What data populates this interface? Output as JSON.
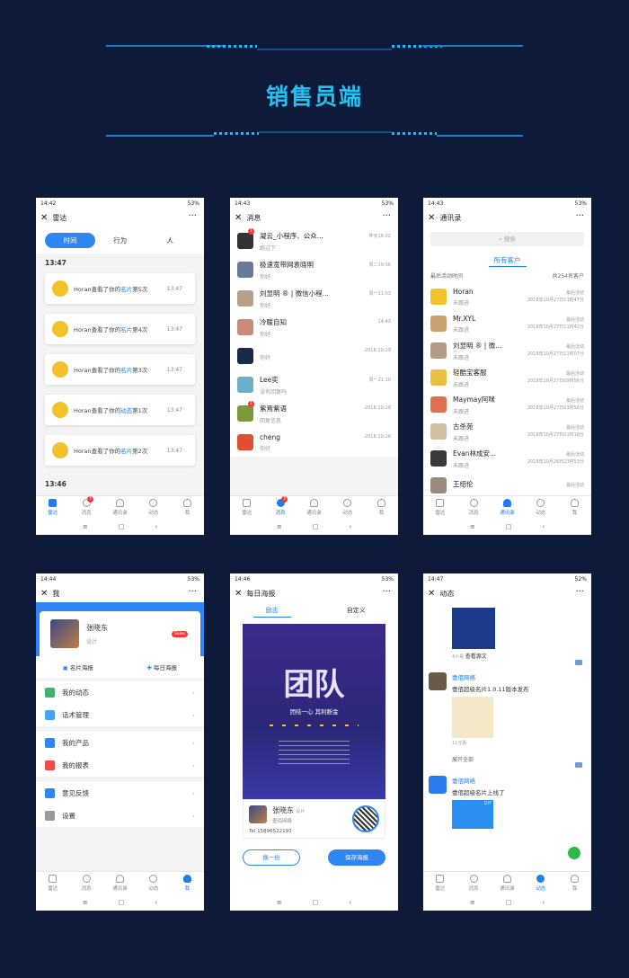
{
  "header": {
    "title": "销售员端"
  },
  "bottom_nav": [
    "雷达",
    "消息",
    "通讯录",
    "动态",
    "我"
  ],
  "sysnav": [
    "≡",
    "□",
    "‹"
  ],
  "p1": {
    "time": "14:42",
    "battery": "53%",
    "title": "雷达",
    "more": "···",
    "tabs": [
      "时间",
      "行为",
      "人"
    ],
    "section1": "13:47",
    "section2": "13:46",
    "cards": [
      {
        "name": "Horan",
        "verb": "查看了你的",
        "obj": "名片",
        "suffix": "第5次",
        "time": "13:47"
      },
      {
        "name": "Horan",
        "verb": "查看了你的",
        "obj": "名片",
        "suffix": "第4次",
        "time": "13:47"
      },
      {
        "name": "Horan",
        "verb": "查看了你的",
        "obj": "名片",
        "suffix": "第3次",
        "time": "13:47"
      },
      {
        "name": "Horan",
        "verb": "查看了你的",
        "obj": "动态",
        "suffix": "第1次",
        "time": "13:47"
      },
      {
        "name": "Horan",
        "verb": "查看了你的",
        "obj": "名片",
        "suffix": "第2次",
        "time": "13:47"
      }
    ],
    "badge": "3"
  },
  "p2": {
    "time": "14:43",
    "battery": "53%",
    "title": "消息",
    "more": "···",
    "badge": "3",
    "rows": [
      {
        "name": "凝云_小程序、公众...",
        "sub": "跑过下",
        "time": "昨天18:02",
        "badge": "1"
      },
      {
        "name": "极速宽带网袁晓明",
        "sub": "你好",
        "time": "周二19:36"
      },
      {
        "name": "刘显明 ® | 微信小程...",
        "sub": "你好",
        "time": "周一11:03"
      },
      {
        "name": "冷暖自知",
        "sub": "你好",
        "time": "14:43"
      },
      {
        "name": "",
        "sub": "你好",
        "time": "2018-10-19"
      },
      {
        "name": "Lee奕",
        "sub": "没有回复吗",
        "time": "周一21:10"
      },
      {
        "name": "紫焉紫语",
        "sub": "回复信息",
        "time": "2018-10-18",
        "badge": "1"
      },
      {
        "name": "cheng",
        "sub": "你好",
        "time": "2018-10-16"
      }
    ]
  },
  "p3": {
    "time": "14:43",
    "battery": "53%",
    "title": "通讯录",
    "more": "···",
    "search": "搜索",
    "tab": "所有客户",
    "sort": "最后活动时间",
    "count": "共254名客户",
    "rows": [
      {
        "name": "Horan",
        "sub": "未跟进",
        "label": "最后活动",
        "time": "2018年10月27日13时47分"
      },
      {
        "name": "Mr.XYL",
        "sub": "未跟进",
        "label": "最后活动",
        "time": "2018年10月27日11时42分"
      },
      {
        "name": "刘显明 ® | 微...",
        "sub": "未跟进",
        "label": "最后活动",
        "time": "2018年10月27日11时07分"
      },
      {
        "name": "轻酷宝客服",
        "sub": "未跟进",
        "label": "最后活动",
        "time": "2018年10月27日09时56分"
      },
      {
        "name": "Maymay阿咪",
        "sub": "未跟进",
        "label": "最后活动",
        "time": "2018年10月27日03时56分"
      },
      {
        "name": "古杀苑",
        "sub": "未跟进",
        "label": "最后活动",
        "time": "2018年10月27日01时18分"
      },
      {
        "name": "Evan林成安...",
        "sub": "未跟进",
        "label": "最后活动",
        "time": "2018年10月26日23时53分"
      },
      {
        "name": "王绍伦",
        "sub": "",
        "label": "最后活动",
        "time": ""
      }
    ]
  },
  "p4": {
    "time": "14:44",
    "battery": "53%",
    "title": "我",
    "more": "···",
    "name": "张晓东",
    "role": "设计",
    "tag": "Sales",
    "poster1": "名片海报",
    "poster2": "每日海报",
    "menu": [
      "我的动态",
      "话术管理",
      "我的产品",
      "我的报表",
      "意见反馈",
      "设置"
    ]
  },
  "p5": {
    "time": "14:46",
    "battery": "53%",
    "title": "每日海报",
    "more": "···",
    "tabs": [
      "励志",
      "自定义"
    ],
    "poster_title": "团队",
    "poster_slogan": "团结一心 其利断金",
    "name": "张晓东",
    "role": "设计",
    "company": "壹佰网络",
    "tel": "Tel 15896522193",
    "btn1": "换一份",
    "btn2": "保存海报"
  },
  "p6": {
    "time": "14:47",
    "battery": "52%",
    "title": "动态",
    "more": "···",
    "img_caption": "查看源文",
    "views1": "4人看",
    "company": "壹佰网络",
    "post": "壹佰超级名片1.0.11版本发布",
    "views2": "11元看",
    "expand": "展开全部",
    "company2": "壹佰网络",
    "post2": "壹佰超级名片上线了",
    "diy": "DIY"
  }
}
